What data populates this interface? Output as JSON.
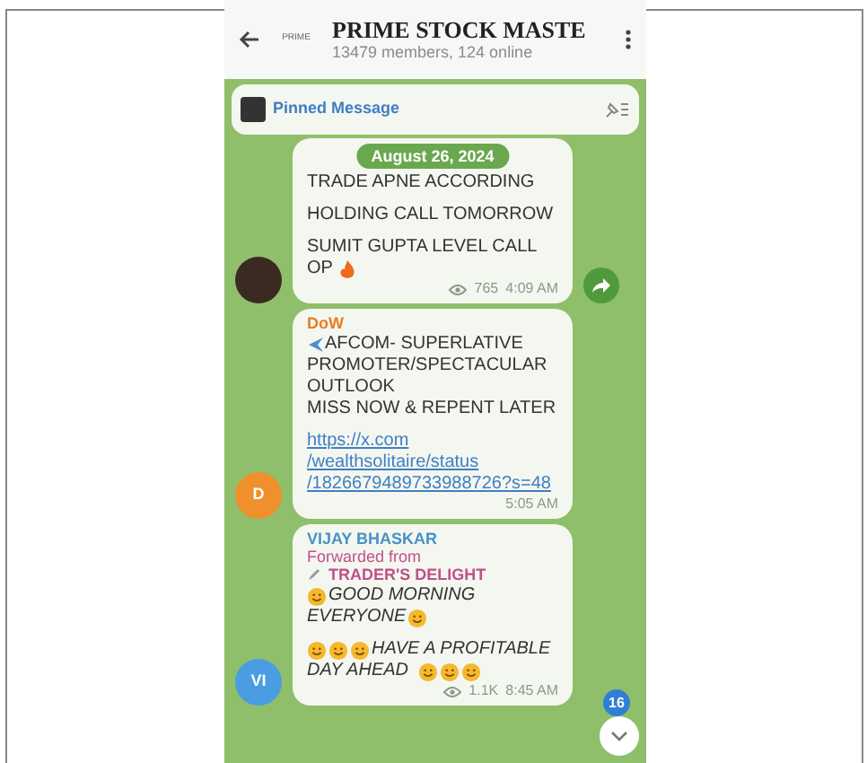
{
  "header": {
    "title": "PRIME STOCK MASTE",
    "subtitle": "13479 members, 124 online",
    "logo_text": "PRIME"
  },
  "pinned": {
    "label": "Pinned Message"
  },
  "date_pill": "August 26, 2024",
  "messages": [
    {
      "kind": "plain",
      "paragraphs": [
        [
          "TRADE APNE ACCORDING"
        ],
        [
          "HOLDING CALL TOMORROW"
        ],
        [
          "SUMIT GUPTA LEVEL CALL",
          "OP"
        ]
      ],
      "fire": true,
      "views": "765",
      "time": "4:09 AM",
      "avatar": {
        "kind": "photo"
      },
      "share": true
    },
    {
      "kind": "plain",
      "sender": "DoW",
      "plane": true,
      "paragraphs": [
        [
          "AFCOM- SUPERLATIVE",
          "PROMOTER/SPECTACULAR",
          "OUTLOOK",
          "MISS NOW & REPENT LATER"
        ]
      ],
      "link": [
        "https://x.com",
        "/wealthsolitaire/status",
        "/1826679489733988726?s=48"
      ],
      "time": "5:05 AM",
      "avatar": {
        "kind": "initials",
        "text": "D",
        "color": "#f0902c"
      },
      "share": false
    },
    {
      "kind": "forwarded",
      "sender": "VIJAY BHASKAR",
      "forwarded_label": "Forwarded from",
      "forwarded_source": "TRADER'S DELIGHT",
      "italic_lines": [
        "GOOD MORNING",
        "EVERYONE"
      ],
      "italic_lines2": [
        "HAVE A PROFITABLE",
        "DAY AHEAD"
      ],
      "views": "1.1K",
      "time": "8:45 AM",
      "avatar": {
        "kind": "initials",
        "text": "VI",
        "color": "#4a9de0"
      },
      "share": false
    }
  ],
  "scroll_button": {
    "badge": "16"
  }
}
